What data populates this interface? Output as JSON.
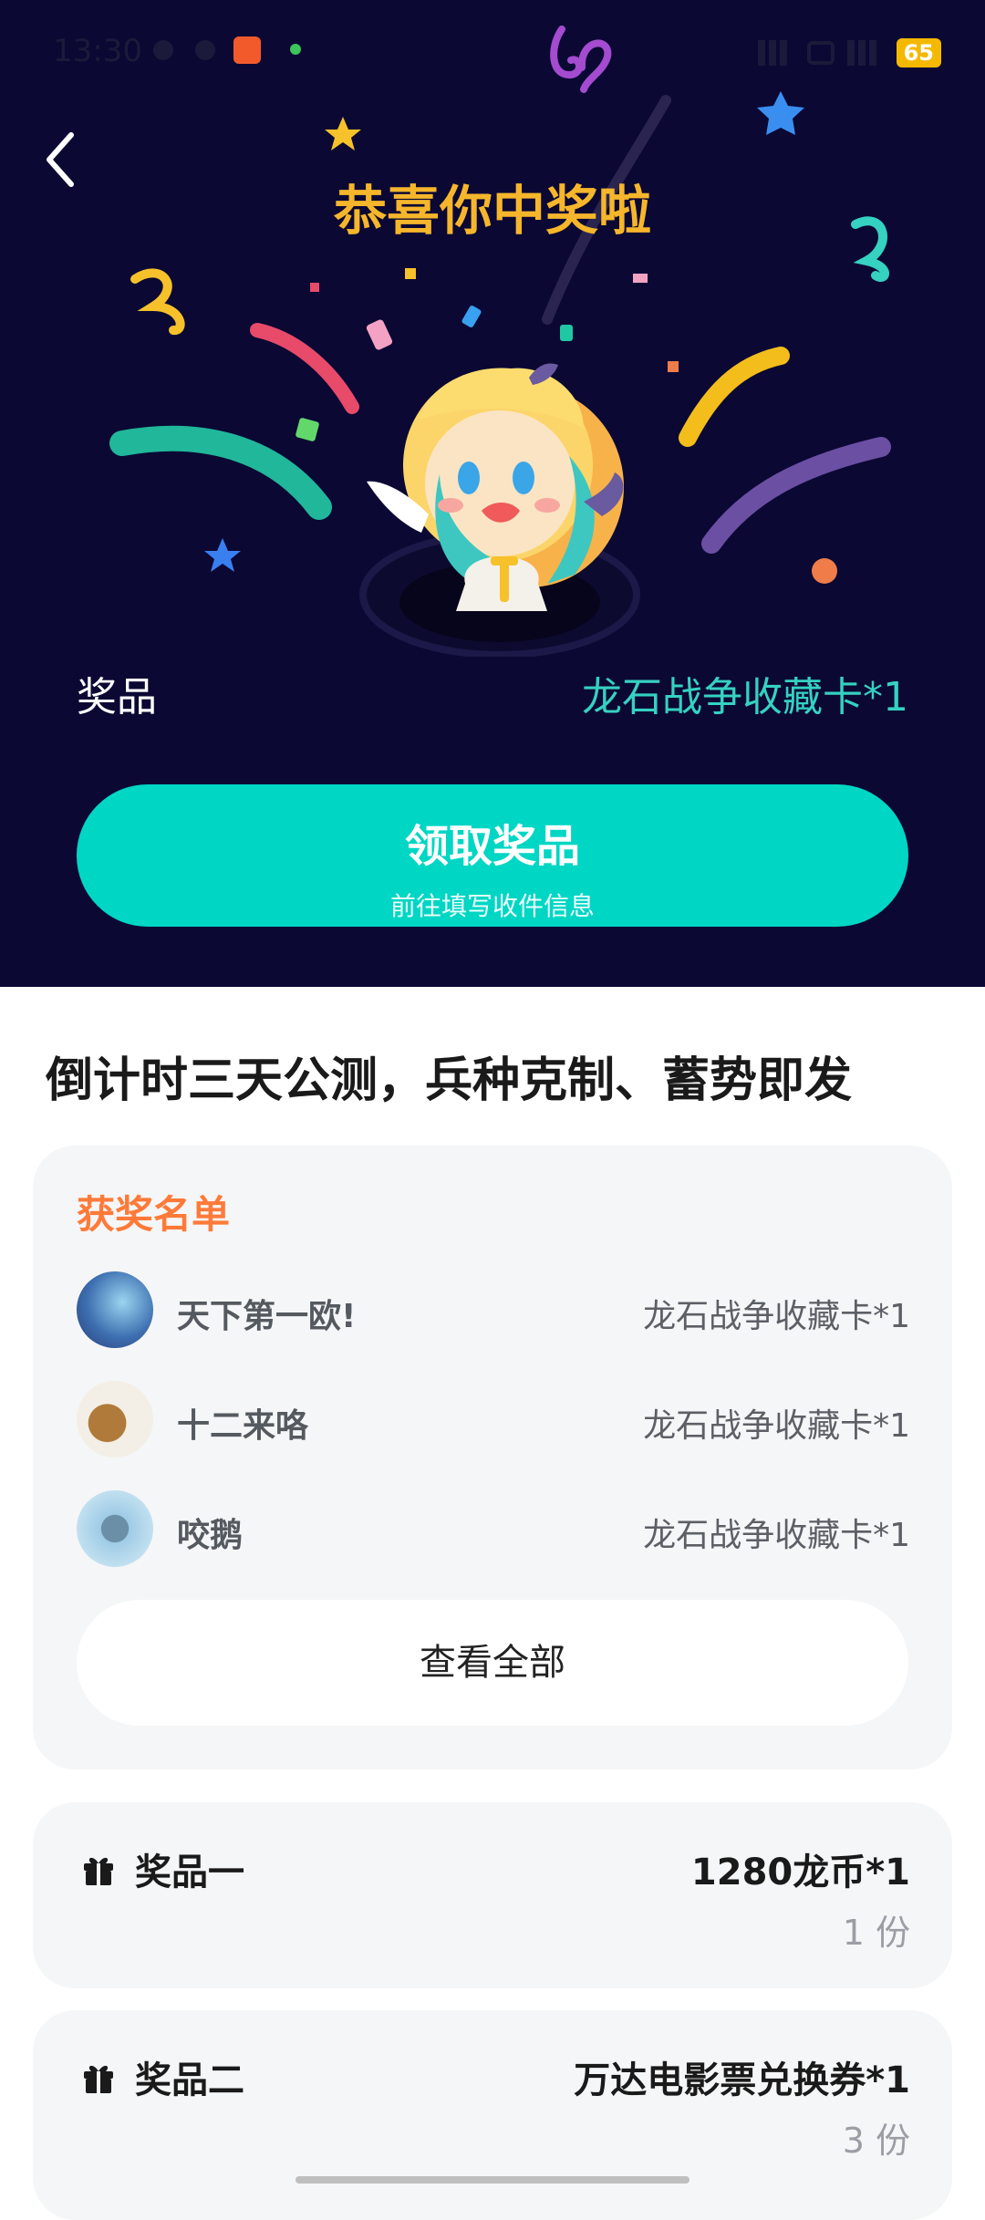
{
  "status_bar": {
    "time": "13:30",
    "battery": "65"
  },
  "hero": {
    "title": "恭喜你中奖啦",
    "prize_label": "奖品",
    "prize_value": "龙石战争收藏卡*1",
    "claim_button": {
      "title": "领取奖品",
      "subtitle": "前往填写收件信息"
    }
  },
  "headline": "倒计时三天公测，兵种克制、蓄势即发",
  "winners": {
    "title": "获奖名单",
    "rows": [
      {
        "name": "天下第一欧!",
        "prize": "龙石战争收藏卡*1"
      },
      {
        "name": "十二来咯",
        "prize": "龙石战争收藏卡*1"
      },
      {
        "name": "咬鹅",
        "prize": "龙石战争收藏卡*1"
      }
    ],
    "view_all": "查看全部"
  },
  "prizes": [
    {
      "name": "奖品一",
      "amount": "1280龙币*1",
      "quantity": "1 份"
    },
    {
      "name": "奖品二",
      "amount": "万达电影票兑换券*1",
      "quantity": "3 份"
    }
  ],
  "colors": {
    "hero_bg": "#0b0834",
    "title_gold": "#f6b62b",
    "prize_teal": "#35d1c1",
    "button_teal": "#00d6c4",
    "winners_title": "#ff7a39",
    "card_bg": "#f5f6f7"
  }
}
